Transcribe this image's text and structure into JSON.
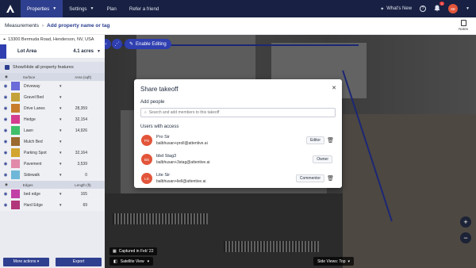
{
  "nav": {
    "items": [
      {
        "label": "Properties",
        "active": true,
        "caret": true
      },
      {
        "label": "Settings",
        "active": false,
        "caret": true
      },
      {
        "label": "Plan",
        "active": false,
        "caret": false
      },
      {
        "label": "Refer a friend",
        "active": false,
        "caret": false
      }
    ],
    "whats_new": "What's New",
    "notif_count": "1",
    "avatar_initials": "SE"
  },
  "subheader": {
    "crumb_root": "Measurements",
    "crumb_current": "Add property name or tag",
    "notes_label": "Notes"
  },
  "panel": {
    "address": "13300 Bermuda Road, Henderson, NV, USA",
    "lot_area_label": "Lot Area",
    "lot_area_value": "4.1 acres",
    "show_hide_label": "Show/Hide all property features",
    "col_surface": "Surface",
    "col_area": "Area (sqft)",
    "features": [
      {
        "name": "Driveway",
        "value": "",
        "color": "#6b6bd9"
      },
      {
        "name": "Gravel Bed",
        "value": "",
        "color": "#c4a23a"
      },
      {
        "name": "Drive Lanes",
        "value": "28,359",
        "color": "#c87d2e"
      },
      {
        "name": "Hedge",
        "value": "32,154",
        "color": "#d43c8f"
      },
      {
        "name": "Lawn",
        "value": "14,926",
        "color": "#3fbf6a"
      },
      {
        "name": "Mulch Bed",
        "value": "",
        "color": "#9b6a2f"
      },
      {
        "name": "Parking Spot",
        "value": "32,164",
        "color": "#d2a52e"
      },
      {
        "name": "Pavement",
        "value": "3,539",
        "color": "#e28aa9"
      },
      {
        "name": "Sidewalk",
        "value": "0",
        "color": "#6fb7d8"
      }
    ],
    "col_edges": "Edges",
    "col_length": "Length (ft)",
    "edges": [
      {
        "name": "bed edge",
        "value": "165",
        "color": "#c23fa6"
      },
      {
        "name": "Hard Edge",
        "value": "69",
        "color": "#b2367a"
      }
    ],
    "more_actions": "More actions",
    "export": "Export"
  },
  "map": {
    "enable_editing": "Enable Editing",
    "captured": "Captured in Feb' 22",
    "satellite_view": "Satellite View",
    "side_views": "Side Views: Top"
  },
  "modal": {
    "title": "Share takeoff",
    "add_people": "Add people",
    "search_placeholder": "Search and add members to this takeoff",
    "users_with_access": "Users with access",
    "users": [
      {
        "initials": "PS",
        "name": "Pro Sir",
        "email": "balbhusan+proll@attentive.ai",
        "role": "Editor",
        "deletable": true
      },
      {
        "initials": "BS",
        "name": "bbd Stag3",
        "email": "balbhusan+3stag@attentive.ai",
        "role": "Owner",
        "deletable": false
      },
      {
        "initials": "LS",
        "name": "Lite Sir",
        "email": "balbhusan+liell@attentive.ai",
        "role": "Commentor",
        "deletable": true
      }
    ]
  }
}
